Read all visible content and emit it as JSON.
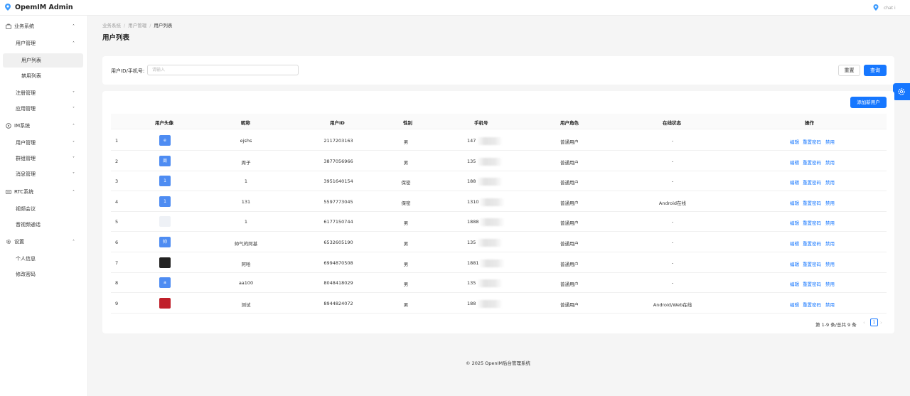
{
  "header": {
    "app_title": "OpemIM Admin",
    "user_name": "chat i"
  },
  "sidebar": {
    "items": [
      {
        "label": "业务系统",
        "icon": "business-icon",
        "chevron": "˄"
      },
      {
        "label": "用户管理",
        "chevron": "˄"
      },
      {
        "label": "用户列表"
      },
      {
        "label": "禁用列表"
      },
      {
        "label": "注册管理",
        "chevron": "˅"
      },
      {
        "label": "应用管理",
        "chevron": "˅"
      },
      {
        "label": "IM系统",
        "icon": "im-icon",
        "chevron": "˄"
      },
      {
        "label": "用户管理",
        "chevron": "˅"
      },
      {
        "label": "群组管理",
        "chevron": "˅"
      },
      {
        "label": "消息管理",
        "chevron": "˅"
      },
      {
        "label": "RTC系统",
        "icon": "rtc-icon",
        "chevron": "˄"
      },
      {
        "label": "视频会议"
      },
      {
        "label": "音视频通话"
      },
      {
        "label": "设置",
        "icon": "settings-icon",
        "chevron": "˄"
      },
      {
        "label": "个人信息"
      },
      {
        "label": "修改密码"
      }
    ]
  },
  "breadcrumb": [
    "业务系统",
    "用户管理",
    "用户列表"
  ],
  "breadcrumb_sep": "/",
  "page_title": "用户列表",
  "search": {
    "label": "用户ID/手机号:",
    "placeholder": "请输入",
    "reset_label": "重置",
    "query_label": "查询"
  },
  "table": {
    "add_label": "添加新用户",
    "columns": [
      "用户头像",
      "昵称",
      "用户ID",
      "性别",
      "手机号",
      "用户角色",
      "在线状态",
      "操作"
    ],
    "actions": [
      "编辑",
      "重置密码",
      "禁用"
    ],
    "rows": [
      {
        "idx": "1",
        "avatar": "e",
        "nickname": "ejshs",
        "user_id": "2117203163",
        "gender": "男",
        "phone": "147",
        "role": "普通用户",
        "status": "-"
      },
      {
        "idx": "2",
        "avatar": "周",
        "nickname": "周子",
        "user_id": "3877056966",
        "gender": "男",
        "phone": "135",
        "role": "普通用户",
        "status": "-"
      },
      {
        "idx": "3",
        "avatar": "1",
        "nickname": "1",
        "user_id": "3951640154",
        "gender": "保密",
        "phone": "188",
        "role": "普通用户",
        "status": "-"
      },
      {
        "idx": "4",
        "avatar": "1",
        "nickname": "131",
        "user_id": "5597773045",
        "gender": "保密",
        "phone": "1310",
        "role": "普通用户",
        "status": "Android在线"
      },
      {
        "idx": "5",
        "avatar": "",
        "nickname": "1",
        "user_id": "6177150744",
        "gender": "男",
        "phone": "1888",
        "role": "普通用户",
        "status": "-"
      },
      {
        "idx": "6",
        "avatar": "帅",
        "nickname": "帅气的阿基",
        "user_id": "6532605190",
        "gender": "男",
        "phone": "135",
        "role": "普通用户",
        "status": "-"
      },
      {
        "idx": "7",
        "avatar": "",
        "nickname": "阿哈",
        "user_id": "6994870508",
        "gender": "男",
        "phone": "1881",
        "role": "普通用户",
        "status": "-"
      },
      {
        "idx": "8",
        "avatar": "a",
        "nickname": "aa100",
        "user_id": "8048418029",
        "gender": "男",
        "phone": "135",
        "role": "普通用户",
        "status": "-"
      },
      {
        "idx": "9",
        "avatar": "",
        "nickname": "测试",
        "user_id": "8944824072",
        "gender": "男",
        "phone": "188",
        "role": "普通用户",
        "status": "Android/Web在线"
      }
    ]
  },
  "pagination": {
    "summary": "第 1-9 条/总共 9 条",
    "current_page": "1",
    "prev": "‹",
    "next": "›"
  },
  "footer": "© 2025 OpenIM后台管理系统",
  "colors": {
    "primary": "#1677ff",
    "background": "#f5f5f5"
  }
}
